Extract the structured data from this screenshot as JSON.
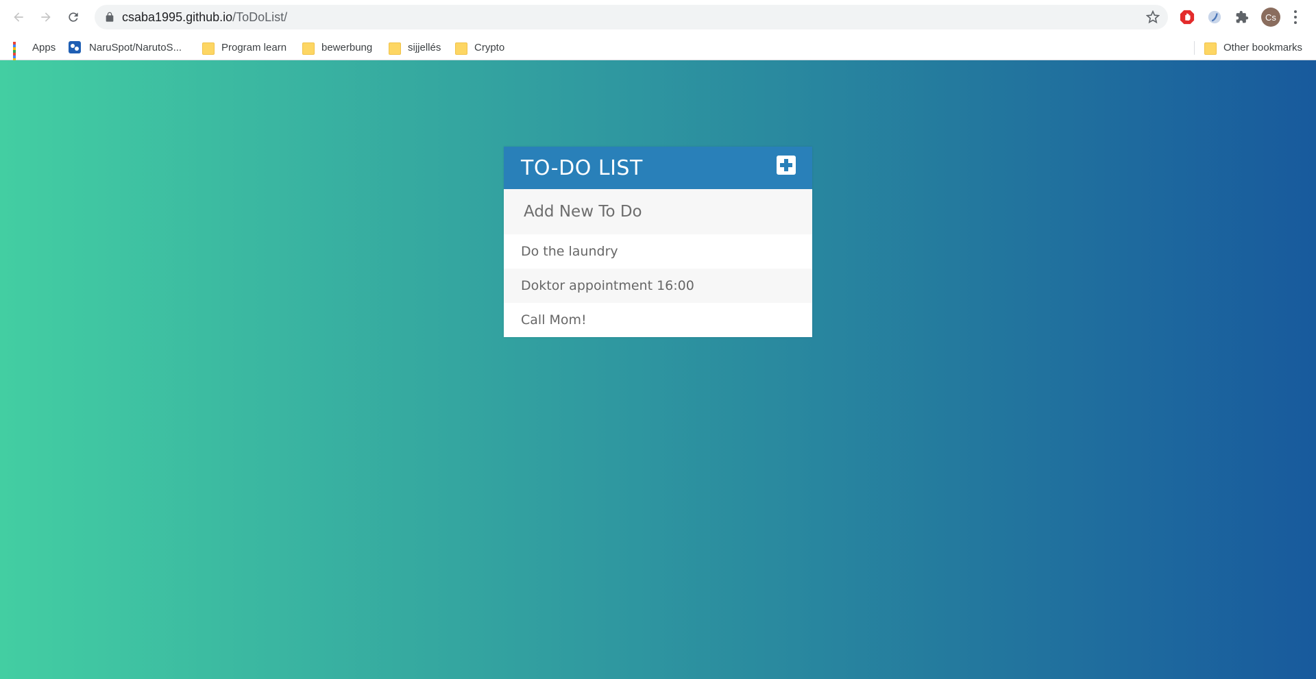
{
  "browser": {
    "url_host": "csaba1995.github.io",
    "url_path": "/ToDoList/",
    "avatar_initials": "Cs",
    "bookmarks": [
      {
        "label": "Apps",
        "icon": "apps-grid-icon"
      },
      {
        "label": "NaruSpot/NarutoS...",
        "icon": "site-favicon-icon"
      },
      {
        "label": "Program learn",
        "icon": "folder-icon"
      },
      {
        "label": "bewerbung",
        "icon": "folder-icon"
      },
      {
        "label": "sijjellés",
        "icon": "folder-icon"
      },
      {
        "label": "Crypto",
        "icon": "folder-icon"
      }
    ],
    "other_bookmarks": "Other bookmarks"
  },
  "page": {
    "background_gradient": [
      "#43cea2",
      "#185a9d"
    ]
  },
  "todo": {
    "title": "TO-DO LIST",
    "accent_color": "#2980b9",
    "input_placeholder": "Add New To Do",
    "input_value": "",
    "items": [
      "Do the laundry",
      "Doktor appointment 16:00",
      "Call Mom!"
    ]
  }
}
